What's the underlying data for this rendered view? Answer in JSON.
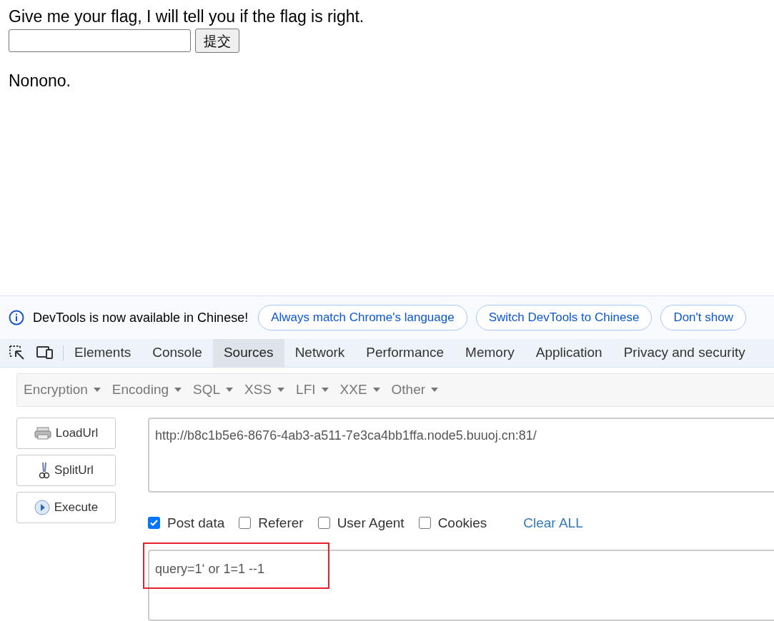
{
  "page": {
    "prompt": "Give me your flag, I will tell you if the flag is right.",
    "submit_button": "提交",
    "result": "Nonono."
  },
  "infobar": {
    "message": "DevTools is now available in Chinese!",
    "buttons": [
      "Always match Chrome's language",
      "Switch DevTools to Chinese",
      "Don't show"
    ]
  },
  "devtools_tabs": [
    {
      "label": "Elements",
      "selected": false
    },
    {
      "label": "Console",
      "selected": false
    },
    {
      "label": "Sources",
      "selected": true
    },
    {
      "label": "Network",
      "selected": false
    },
    {
      "label": "Performance",
      "selected": false
    },
    {
      "label": "Memory",
      "selected": false
    },
    {
      "label": "Application",
      "selected": false
    },
    {
      "label": "Privacy and security",
      "selected": false
    }
  ],
  "hackbar": {
    "menus": [
      "Encryption",
      "Encoding",
      "SQL",
      "XSS",
      "LFI",
      "XXE",
      "Other"
    ],
    "actions": [
      {
        "label": "LoadUrl",
        "kind": "load"
      },
      {
        "label": "SplitUrl",
        "kind": "split"
      },
      {
        "label": "Execute",
        "kind": "execute"
      }
    ],
    "url": "http://b8c1b5e6-8676-4ab3-a511-7e3ca4bb1ffa.node5.buuoj.cn:81/",
    "options": [
      {
        "label": "Post data",
        "checked": true
      },
      {
        "label": "Referer",
        "checked": false
      },
      {
        "label": "User Agent",
        "checked": false
      },
      {
        "label": "Cookies",
        "checked": false
      }
    ],
    "clear_link": "Clear ALL",
    "post_body": "query=1‘ or 1=1 --1",
    "highlighted": true
  }
}
